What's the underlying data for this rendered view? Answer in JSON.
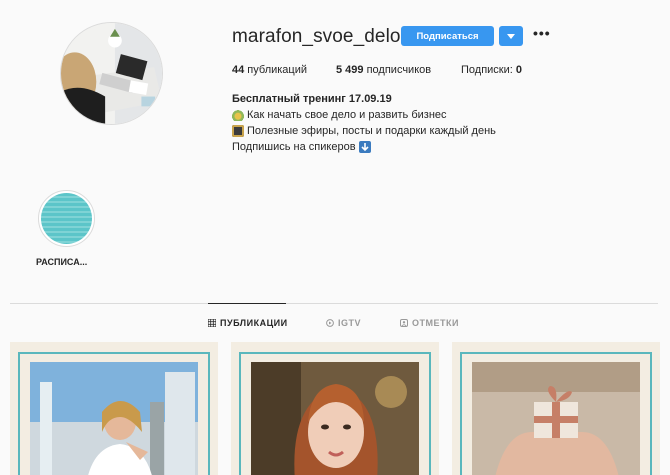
{
  "profile": {
    "username": "marafon_svoe_delo",
    "follow_label": "Подписаться",
    "dropdown_icon": "chevron-down-icon",
    "more_icon": "more-options-icon",
    "more_glyph": "•••",
    "stats": {
      "posts_count": "44",
      "posts_label": " публикаций",
      "followers_count": "5 499",
      "followers_label": " подписчиков",
      "following_label": "Подписки: ",
      "following_count": "0"
    },
    "bio": {
      "name": "Бесплатный тренинг 17.09.19",
      "line1": "Как начать свое дело и развить бизнес",
      "line2": "Полезные эфиры, посты и подарки каждый день",
      "line3": "Подпишись на спикеров"
    }
  },
  "highlights": [
    {
      "label": "РАСПИСА..."
    }
  ],
  "tabs": [
    {
      "label": "ПУБЛИКАЦИИ",
      "icon": "grid-icon",
      "active": true
    },
    {
      "label": "IGTV",
      "icon": "igtv-icon",
      "active": false
    },
    {
      "label": "ОТМЕТКИ",
      "icon": "tag-icon",
      "active": false
    }
  ],
  "colors": {
    "accent": "#3897f0",
    "frame": "#5ab7bd",
    "post_bg": "#f3ede2"
  }
}
